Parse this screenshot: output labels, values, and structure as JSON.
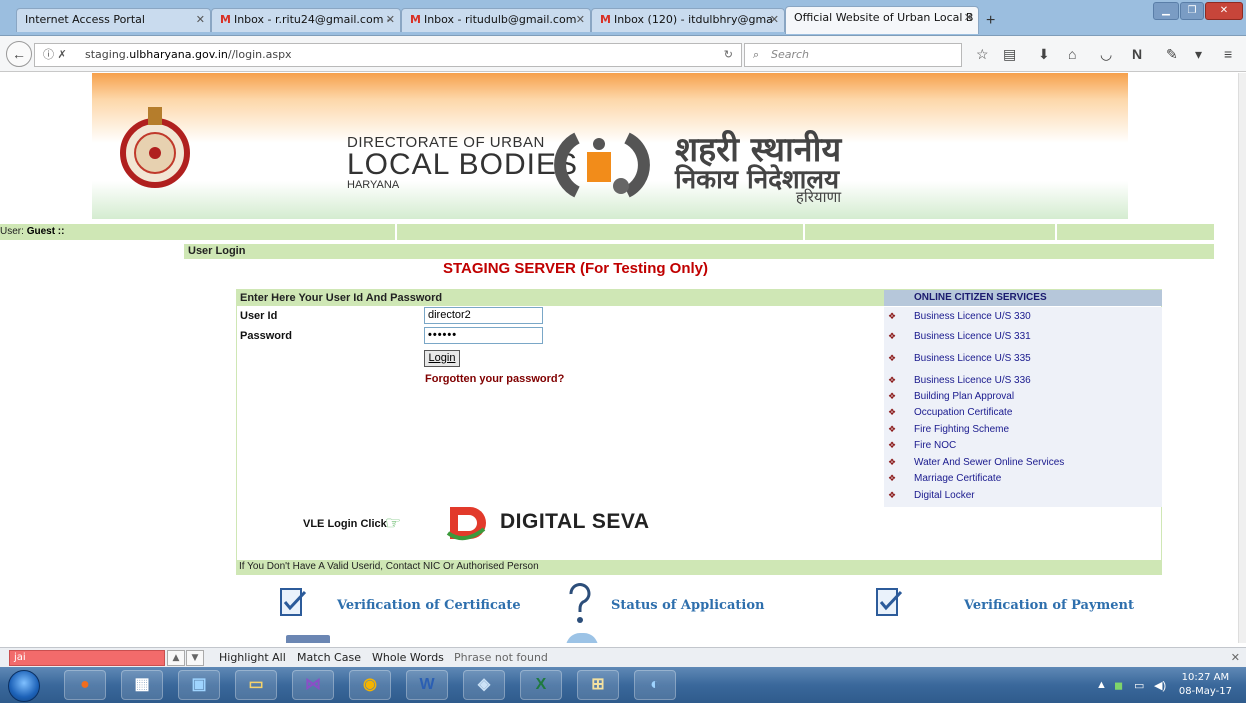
{
  "browser": {
    "tabs": [
      {
        "label": "Internet Access Portal",
        "gmail": false,
        "active": false
      },
      {
        "label": "Inbox - r.ritu24@gmail.com -",
        "gmail": true,
        "active": false
      },
      {
        "label": "Inbox - ritudulb@gmail.com",
        "gmail": true,
        "active": false
      },
      {
        "label": "Inbox (120) - itdulbhry@gma",
        "gmail": true,
        "active": false
      },
      {
        "label": "Official Website of Urban Local B",
        "gmail": false,
        "active": true
      }
    ],
    "url_prefix": "staging.",
    "url_domain": "ulbharyana.gov.in",
    "url_path": "//login.aspx",
    "search_placeholder": "Search"
  },
  "banner": {
    "en_line1": "DIRECTORATE OF URBAN",
    "en_line2": "LOCAL BODIES",
    "en_line3": "HARYANA",
    "hi_line1": "शहरी स्थानीय",
    "hi_line1b": "निकाय निदेशालय",
    "hi_line2": "हरियाणा"
  },
  "user_bar": {
    "label": "User:",
    "value": "Guest ::"
  },
  "login": {
    "section_title": "User Login",
    "staging_notice": "STAGING SERVER (For Testing Only)",
    "panel_title": "Enter Here Your User Id And Password",
    "userid_label": "User Id",
    "userid_value": "director2",
    "password_label": "Password",
    "password_value": "••••••",
    "login_button": "Login",
    "forgot_link": "Forgotten your password?",
    "vle_label": "VLE Login Click",
    "digital_seva": "DIGITAL SEVA",
    "notice": "If You Don't Have A Valid Userid, Contact NIC Or Authorised Person"
  },
  "services": {
    "title": "ONLINE CITIZEN SERVICES",
    "items": [
      "Business Licence U/S 330",
      "Business Licence U/S 331",
      "Business Licence U/S 335",
      "Business Licence U/S 336",
      "Building Plan Approval",
      "Occupation Certificate",
      "Fire Fighting Scheme",
      "Fire NOC",
      "Water And Sewer Online Services",
      "Marriage Certificate",
      "Digital Locker"
    ]
  },
  "bottom_links": {
    "verify_certificate": "Verification of Certificate",
    "status_application": "Status of Application",
    "verify_payment": "Verification of Payment"
  },
  "findbar": {
    "query": "jai",
    "highlight_all": "Highlight All",
    "match_case": "Match Case",
    "whole_words": "Whole Words",
    "status": "Phrase not found"
  },
  "taskbar": {
    "time": "10:27 AM",
    "date": "08-May-17"
  },
  "colors": {
    "green_bar": "#cfe7b5",
    "staging_red": "#c00000",
    "service_link": "#1a1a8e",
    "link_blue": "#2e6fad"
  }
}
